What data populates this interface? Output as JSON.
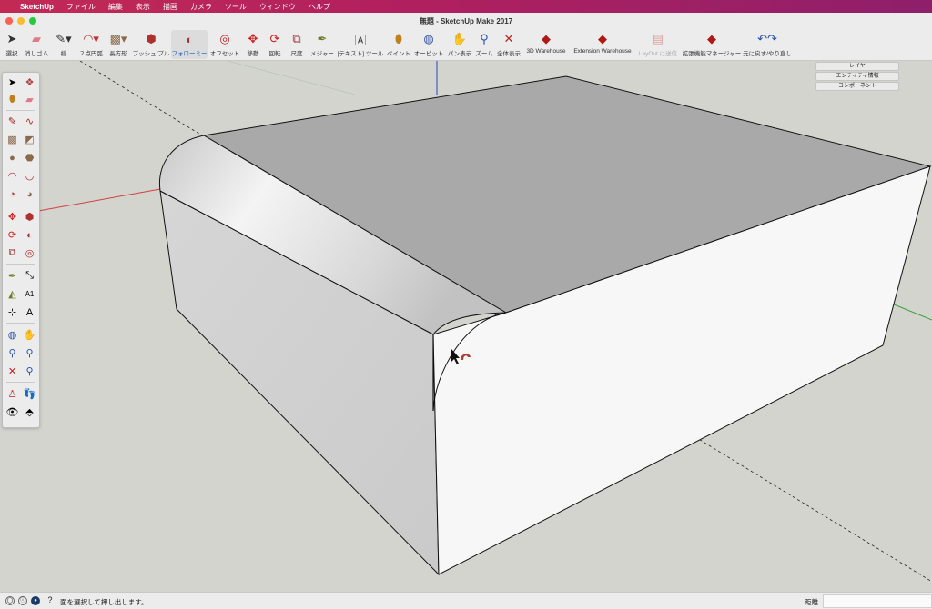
{
  "menubar": {
    "apple": "",
    "app_name": "SketchUp",
    "items": [
      "ファイル",
      "編集",
      "表示",
      "描画",
      "カメラ",
      "ツール",
      "ウィンドウ",
      "ヘルプ"
    ]
  },
  "window": {
    "title": "無題 - SketchUp Make 2017"
  },
  "toolbar": {
    "items": [
      {
        "label": "選択",
        "icon": "select-arrow-icon",
        "glyph": "➤"
      },
      {
        "label": "消しゴム",
        "icon": "eraser-icon",
        "glyph": "▰"
      },
      {
        "label": "線",
        "icon": "pencil-icon",
        "glyph": "✎"
      },
      {
        "label": "２点円弧",
        "icon": "arc-icon",
        "glyph": "◠"
      },
      {
        "label": "長方形",
        "icon": "rectangle-icon",
        "glyph": "▩"
      },
      {
        "label": "プッシュ/プル",
        "icon": "push-pull-icon",
        "glyph": "⬢"
      },
      {
        "label": "フォローミー",
        "icon": "follow-me-icon",
        "glyph": "◐"
      },
      {
        "label": "オフセット",
        "icon": "offset-icon",
        "glyph": "◎"
      },
      {
        "label": "移動",
        "icon": "move-icon",
        "glyph": "✥"
      },
      {
        "label": "回転",
        "icon": "rotate-icon",
        "glyph": "⟳"
      },
      {
        "label": "尺度",
        "icon": "scale-icon",
        "glyph": "⧉"
      },
      {
        "label": "メジャー",
        "icon": "tape-measure-icon",
        "glyph": "✒"
      },
      {
        "label": "[テキスト] ツール",
        "icon": "text-tool-icon",
        "glyph": "🄰"
      },
      {
        "label": "ペイント",
        "icon": "paint-bucket-icon",
        "glyph": "⬮"
      },
      {
        "label": "オービット",
        "icon": "orbit-icon",
        "glyph": "◍"
      },
      {
        "label": "パン表示",
        "icon": "pan-hand-icon",
        "glyph": "✋"
      },
      {
        "label": "ズーム",
        "icon": "zoom-icon",
        "glyph": "⚲"
      },
      {
        "label": "全体表示",
        "icon": "zoom-extents-icon",
        "glyph": "✕"
      },
      {
        "label": "3D Warehouse",
        "icon": "warehouse-icon",
        "glyph": "◆"
      },
      {
        "label": "Extension Warehouse",
        "icon": "extension-warehouse-icon",
        "glyph": "◆"
      },
      {
        "label": "LayOut に送信",
        "icon": "layout-send-icon",
        "glyph": "▤"
      },
      {
        "label": "拡張機能マネージャー",
        "icon": "extension-manager-icon",
        "glyph": "◆"
      },
      {
        "label": "元に戻す/やり直し",
        "icon": "undo-redo-icon",
        "glyph": "↶↷"
      }
    ]
  },
  "tray": {
    "items": [
      "レイヤ",
      "エンティティ情報",
      "コンポーネント"
    ]
  },
  "status": {
    "message": "面を選択して押し出します。",
    "measure_label": "距離",
    "measure_value": ""
  },
  "colors": {
    "menubar": "#b0205f",
    "red_axis": "#d03030",
    "green_axis": "#30a030",
    "blue_axis": "#2030c0",
    "active_tool": "#1b57c7"
  },
  "palette": {
    "tools": [
      "select-arrow-icon",
      "component-icon",
      "paint-bucket-icon",
      "eraser-icon",
      "pencil-icon",
      "freehand-icon",
      "rectangle-icon",
      "rotated-rectangle-icon",
      "circle-icon",
      "polygon-icon",
      "arc-icon",
      "two-point-arc-icon",
      "three-point-arc-icon",
      "pie-icon",
      "move-icon",
      "push-pull-icon",
      "rotate-icon",
      "follow-me-icon",
      "scale-icon",
      "offset-icon",
      "tape-measure-icon",
      "dimension-icon",
      "protractor-icon",
      "text-icon",
      "axes-icon",
      "3d-text-icon",
      "orbit-icon",
      "pan-icon",
      "zoom-icon",
      "zoom-window-icon",
      "zoom-extents-icon",
      "previous-view-icon",
      "position-camera-icon",
      "walk-icon",
      "look-around-icon",
      "section-plane-icon"
    ]
  }
}
